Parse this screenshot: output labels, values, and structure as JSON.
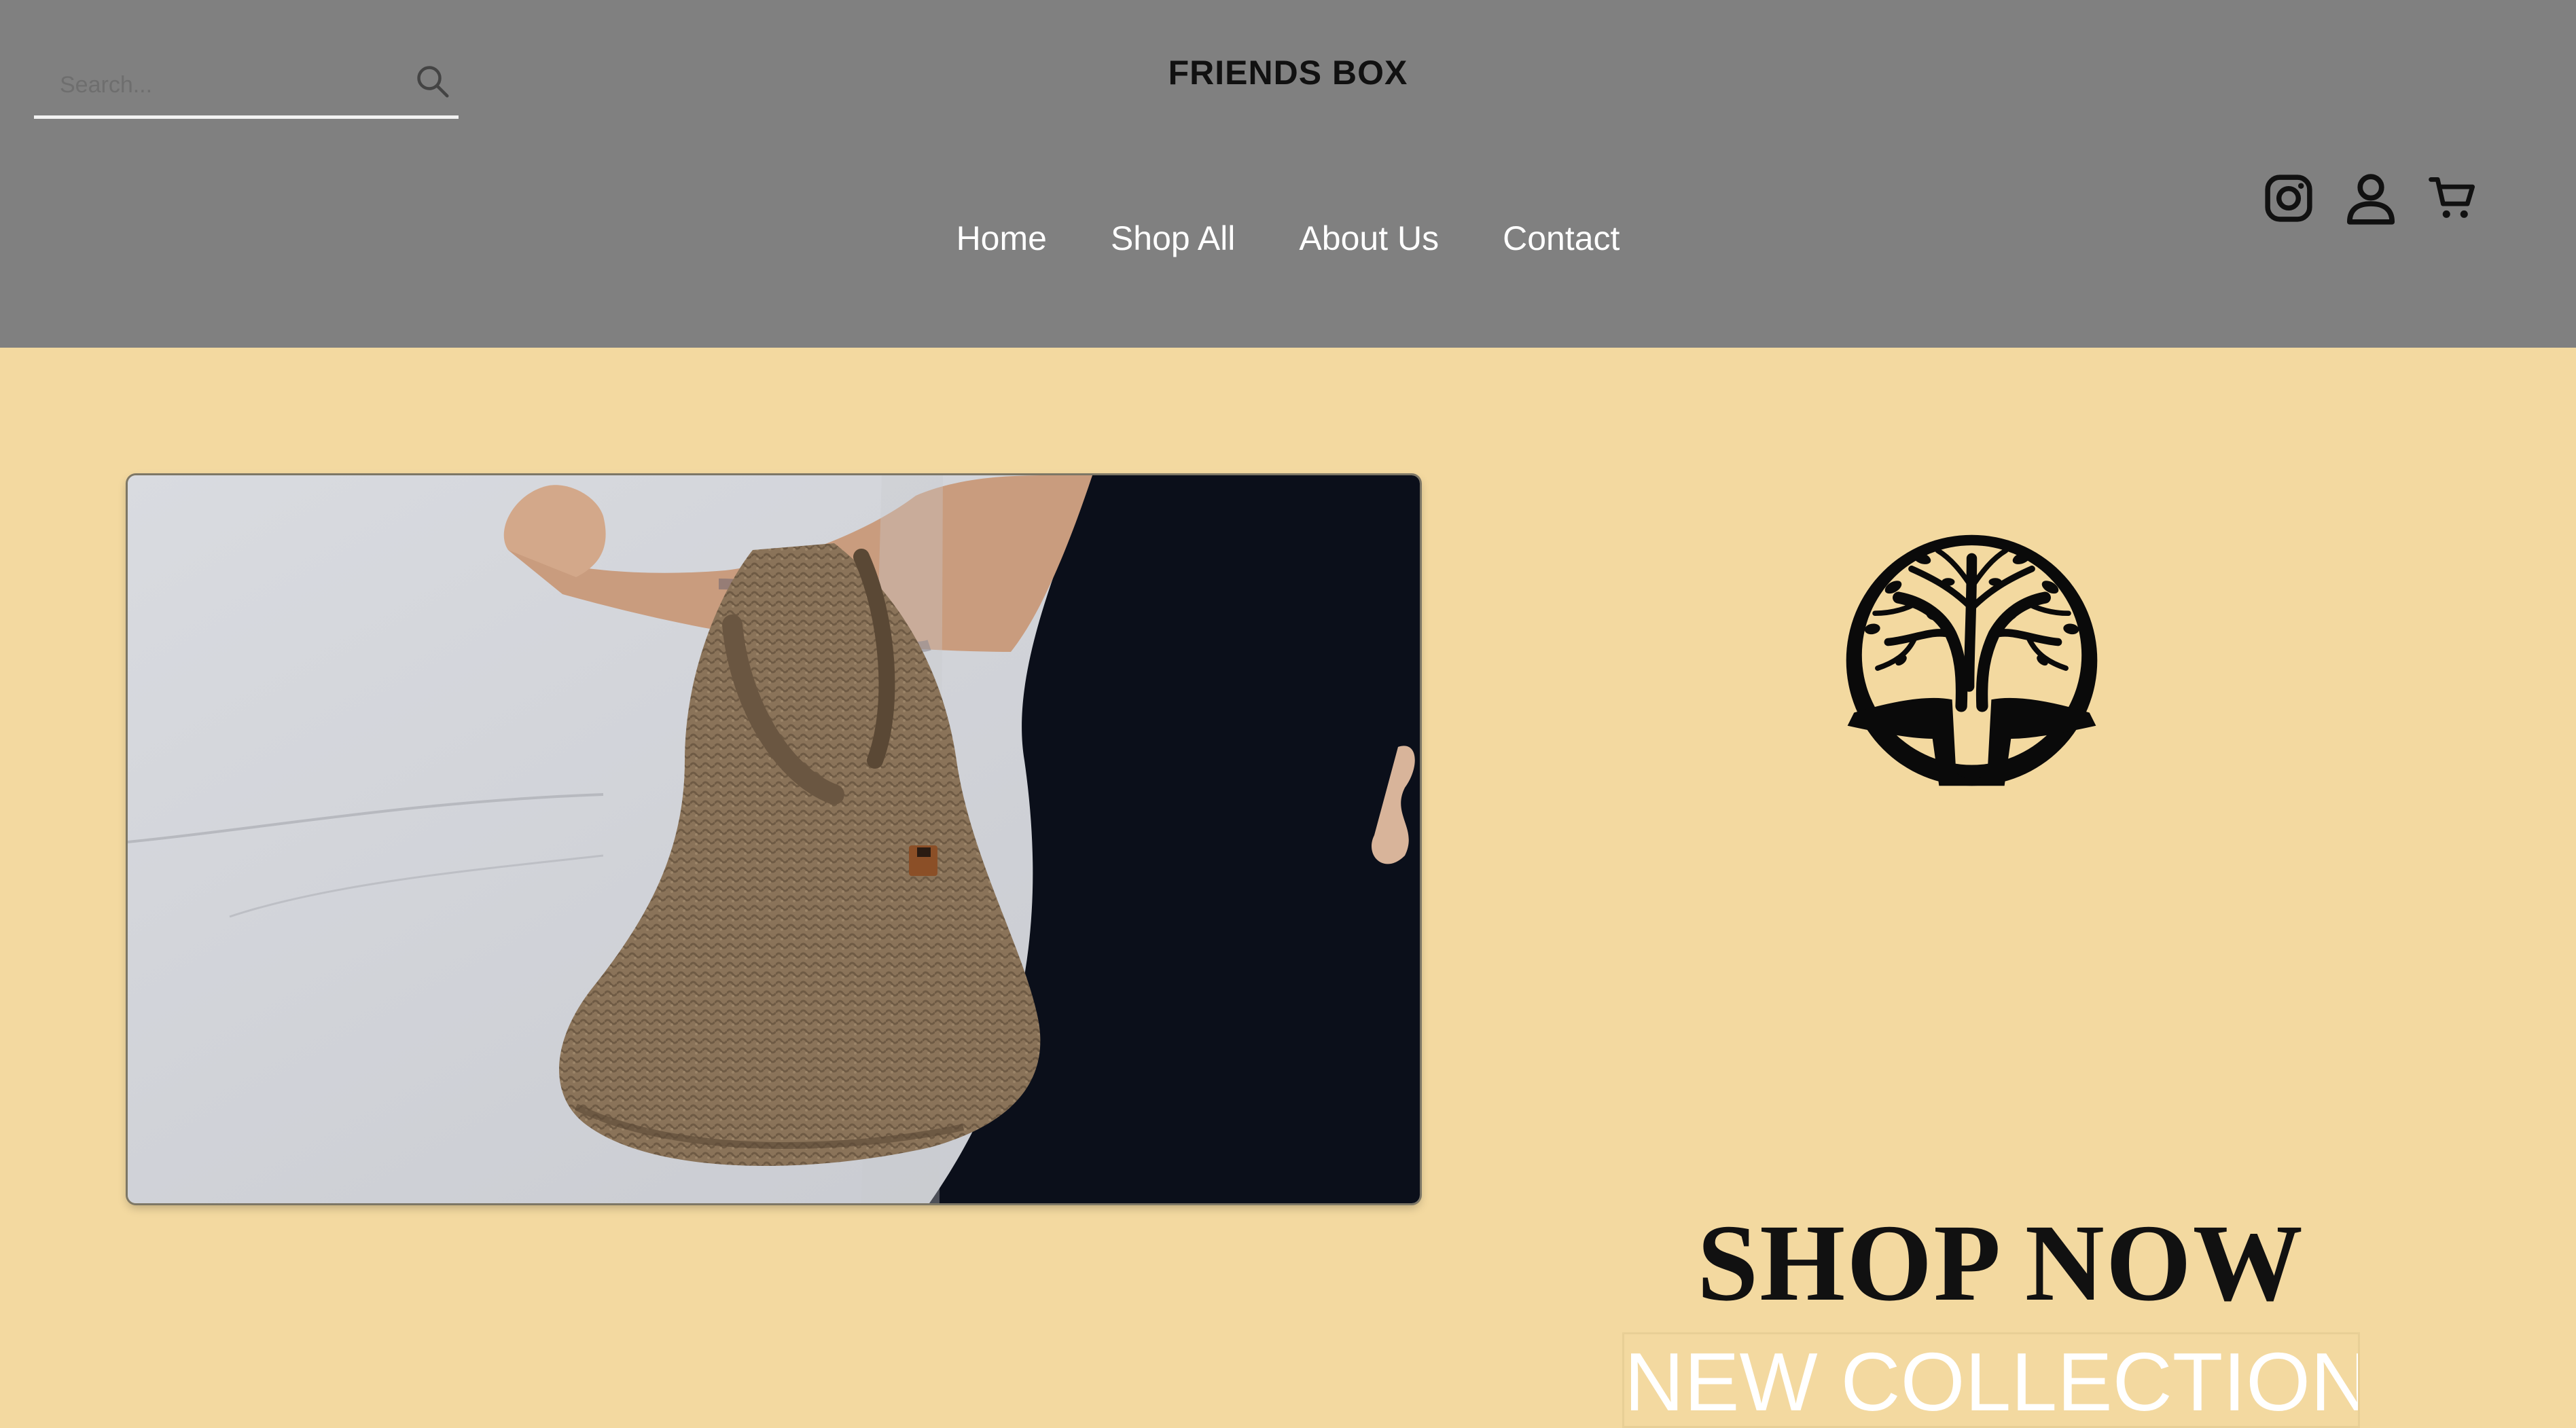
{
  "search": {
    "placeholder": "Search..."
  },
  "brand": {
    "title": "FRIENDS BOX"
  },
  "nav": {
    "items": [
      {
        "label": "Home"
      },
      {
        "label": "Shop All"
      },
      {
        "label": "About Us"
      },
      {
        "label": "Contact"
      }
    ]
  },
  "header_icons": [
    "instagram-icon",
    "account-icon",
    "cart-icon"
  ],
  "hero": {
    "image": "crocheted-bag-photo",
    "shop_now": "SHOP NOW",
    "new_collection": "NEW COLLECTION"
  },
  "logo": {
    "icon": "tree-of-life-icon"
  },
  "colors": {
    "header_bg": "#808080",
    "page_bg": "#f3d9a0",
    "nav_text": "#ffffff",
    "headline": "#111111"
  }
}
